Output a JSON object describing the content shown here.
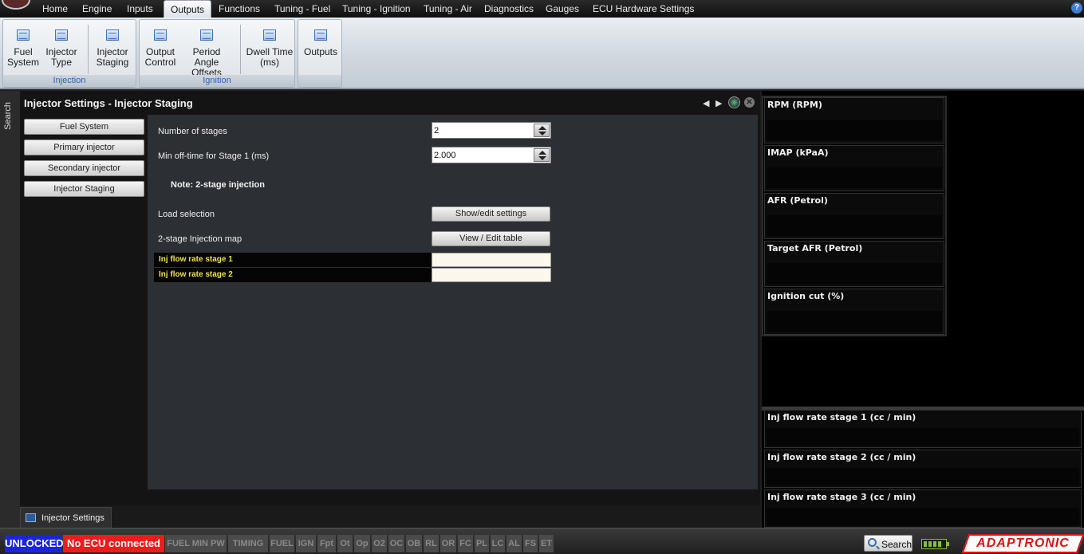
{
  "menubar": {
    "items": [
      "Home",
      "Engine",
      "Inputs",
      "Outputs",
      "Functions",
      "Tuning - Fuel",
      "Tuning - Ignition",
      "Tuning - Air",
      "Diagnostics",
      "Gauges",
      "ECU Hardware Settings"
    ],
    "active": "Outputs",
    "help": "?"
  },
  "ribbon": {
    "groups": [
      {
        "label": "Injection",
        "buttons": [
          {
            "line1": "Fuel",
            "line2": "System"
          },
          {
            "line1": "Injector",
            "line2": "Type"
          },
          {
            "line1": "Injector",
            "line2": "Staging"
          }
        ]
      },
      {
        "label": "Ignition",
        "buttons": [
          {
            "line1": "Output",
            "line2": "Control"
          },
          {
            "line1": "Period Angle",
            "line2": "Offsets"
          },
          {
            "line1": "Dwell Time",
            "line2": "(ms)"
          }
        ]
      },
      {
        "label": "",
        "buttons": [
          {
            "line1": "Outputs",
            "line2": ""
          }
        ]
      }
    ]
  },
  "search_strip": {
    "label": "Search"
  },
  "panel": {
    "title": "Injector Settings - Injector Staging",
    "nav_left": "◀",
    "nav_right": "▶",
    "close": "✕",
    "side_buttons": [
      "Fuel System",
      "Primary injector",
      "Secondary injector",
      "Injector Staging"
    ],
    "fields": {
      "stages_label": "Number of stages",
      "stages_value": "2",
      "offtime_label": "Min off-time for Stage 1 (ms)",
      "offtime_value": "2.000"
    },
    "note": "Note: 2-stage injection",
    "load_selection": {
      "label": "Load selection",
      "button": "Show/edit settings"
    },
    "injection_map": {
      "label": "2-stage Injection map",
      "button": "View / Edit table"
    },
    "gauge_rows": [
      "Inj flow rate stage 1",
      "Inj flow rate stage 2"
    ]
  },
  "tab": {
    "label": "Injector Settings"
  },
  "gauges_top": [
    "RPM (RPM)",
    "IMAP  (kPaA)",
    "AFR (Petrol)",
    "Target AFR (Petrol)",
    "Ignition cut (%)"
  ],
  "gauges_bottom": [
    "Inj flow rate stage 1 (cc / min)",
    "Inj flow rate stage 2 (cc / min)",
    "Inj flow rate stage 3 (cc / min)"
  ],
  "status": {
    "unlocked": "UNLOCKED",
    "ecu": "No ECU connected",
    "flags": [
      "FUEL MIN PW",
      "TIMING",
      "FUEL",
      "IGN",
      "Fpt",
      "Ot",
      "Op",
      "O2",
      "OC",
      "OB",
      "RL",
      "OR",
      "FC",
      "PL",
      "LC",
      "AL",
      "FS",
      "ET"
    ],
    "search": "Search",
    "brand": "ADAPTRONIC"
  },
  "colors": {
    "unlocked_bg": "#1d24e0",
    "ecu_bg": "#ee1c1c",
    "gauge_label": "#f0e24a",
    "ribbon_group_label": "#2e62b6"
  }
}
